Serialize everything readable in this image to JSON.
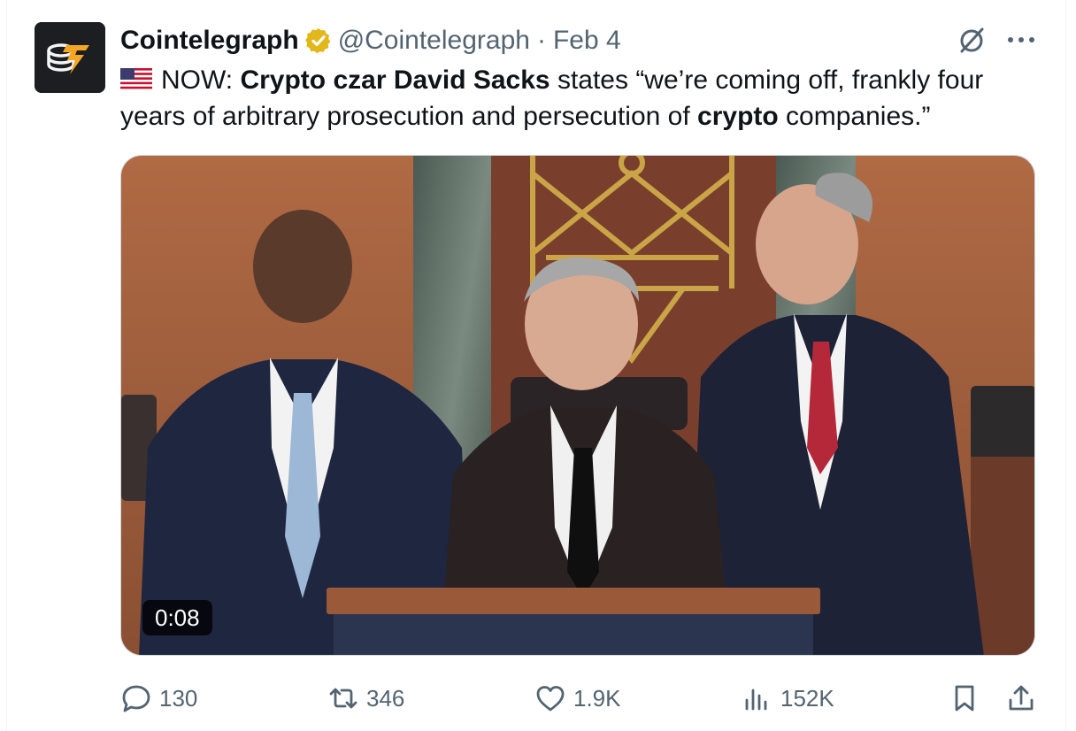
{
  "author": {
    "name": "Cointelegraph",
    "handle": "@Cointelegraph",
    "separator": "·",
    "date": "Feb 4",
    "verified": true,
    "avatar_icon": "cointelegraph-logo-icon",
    "colors": {
      "avatar_bg": "#1c1e21",
      "logo": "#f5a623",
      "verified_badge": "#e2b719"
    }
  },
  "tweet": {
    "flag_icon": "us-flag-icon",
    "prefix": "NOW: ",
    "bold_1": "Crypto czar David Sacks",
    "text_1": " states “we’re coming off, frankly four years of arbitrary prosecution and persecution of ",
    "bold_2": "crypto",
    "text_2": " companies.”"
  },
  "media": {
    "type": "video",
    "duration": "0:08"
  },
  "actions": {
    "replies": "130",
    "reposts": "346",
    "likes": "1.9K",
    "views": "152K",
    "icons": [
      "reply-icon",
      "repost-icon",
      "like-icon",
      "views-icon",
      "bookmark-icon",
      "share-icon"
    ]
  },
  "theme": {
    "text": "#0f1419",
    "muted": "#536471",
    "border": "#cfd9de"
  }
}
